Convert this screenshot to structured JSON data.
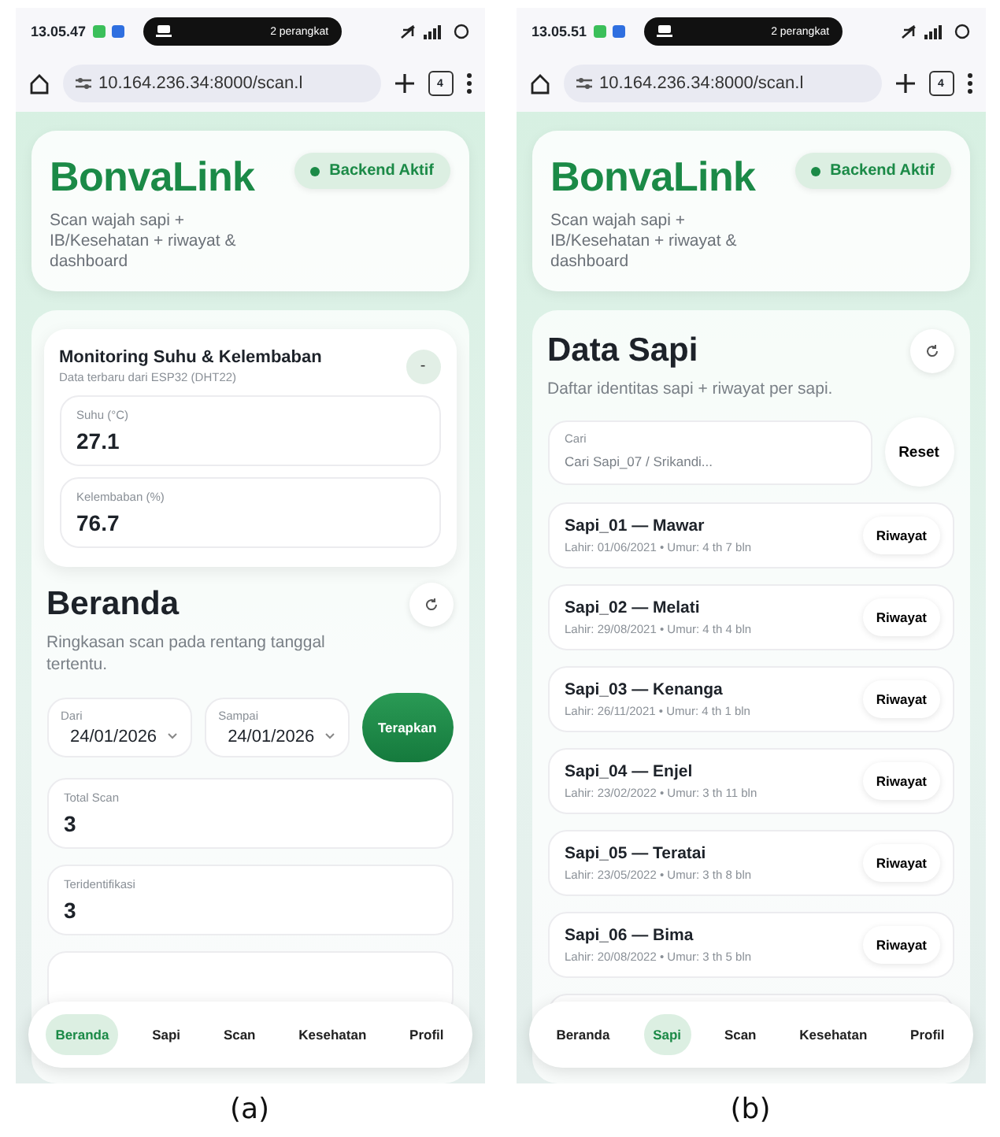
{
  "panels": [
    {
      "caption": "(a)",
      "status_bar": {
        "time": "13.05.47",
        "cast_label": "2 perangkat"
      },
      "browser": {
        "url": "10.164.236.34:8000/scan.l",
        "tab_count": "4"
      },
      "header": {
        "title": "BonvaLink",
        "subtitle": "Scan wajah sapi + IB/Kesehatan + riwayat & dashboard",
        "badge": "Backend Aktif"
      },
      "blocks": [
        {
          "kind": "monitor",
          "title": "Monitoring Suhu & Kelembaban",
          "subtitle": "Data terbaru dari ESP32 (DHT22)",
          "toggle": "-",
          "metrics": [
            {
              "label": "Suhu (°C)",
              "value": "27.1"
            },
            {
              "label": "Kelembaban (%)",
              "value": "76.7"
            }
          ]
        },
        {
          "kind": "heading",
          "title": "Beranda",
          "subtitle": "Ringkasan scan pada rentang tanggal tertentu."
        },
        {
          "kind": "date_filter",
          "fields": [
            {
              "label": "Dari",
              "value": "24/01/2026"
            },
            {
              "label": "Sampai",
              "value": "24/01/2026"
            }
          ],
          "button": "Terapkan"
        },
        {
          "kind": "stat",
          "label": "Total Scan",
          "value": "3"
        },
        {
          "kind": "stat",
          "label": "Teridentifikasi",
          "value": "3"
        },
        {
          "kind": "blank"
        }
      ],
      "nav": [
        {
          "label": "Beranda",
          "selected": true
        },
        {
          "label": "Sapi",
          "selected": false
        },
        {
          "label": "Scan",
          "selected": false
        },
        {
          "label": "Kesehatan",
          "selected": false
        },
        {
          "label": "Profil",
          "selected": false
        }
      ]
    },
    {
      "caption": "(b)",
      "status_bar": {
        "time": "13.05.51",
        "cast_label": "2 perangkat"
      },
      "browser": {
        "url": "10.164.236.34:8000/scan.l",
        "tab_count": "4"
      },
      "header": {
        "title": "BonvaLink",
        "subtitle": "Scan wajah sapi + IB/Kesehatan + riwayat & dashboard",
        "badge": "Backend Aktif"
      },
      "blocks": [
        {
          "kind": "heading",
          "title": "Data Sapi",
          "subtitle": "Daftar identitas sapi + riwayat per sapi."
        },
        {
          "kind": "search",
          "label": "Cari",
          "placeholder": "Cari Sapi_07 / Srikandi...",
          "button": "Reset"
        },
        {
          "kind": "cattle",
          "name": "Sapi_01 — Mawar",
          "info": "Lahir: 01/06/2021 • Umur: 4 th 7 bln",
          "button": "Riwayat"
        },
        {
          "kind": "cattle",
          "name": "Sapi_02 — Melati",
          "info": "Lahir: 29/08/2021 • Umur: 4 th 4 bln",
          "button": "Riwayat"
        },
        {
          "kind": "cattle",
          "name": "Sapi_03 — Kenanga",
          "info": "Lahir: 26/11/2021 • Umur: 4 th 1 bln",
          "button": "Riwayat"
        },
        {
          "kind": "cattle",
          "name": "Sapi_04 — Enjel",
          "info": "Lahir: 23/02/2022 • Umur: 3 th 11 bln",
          "button": "Riwayat"
        },
        {
          "kind": "cattle",
          "name": "Sapi_05 — Teratai",
          "info": "Lahir: 23/05/2022 • Umur: 3 th 8 bln",
          "button": "Riwayat"
        },
        {
          "kind": "cattle",
          "name": "Sapi_06 — Bima",
          "info": "Lahir: 20/08/2022 • Umur: 3 th 5 bln",
          "button": "Riwayat"
        },
        {
          "kind": "blank"
        }
      ],
      "nav": [
        {
          "label": "Beranda",
          "selected": false
        },
        {
          "label": "Sapi",
          "selected": true
        },
        {
          "label": "Scan",
          "selected": false
        },
        {
          "label": "Kesehatan",
          "selected": false
        },
        {
          "label": "Profil",
          "selected": false
        }
      ]
    }
  ]
}
